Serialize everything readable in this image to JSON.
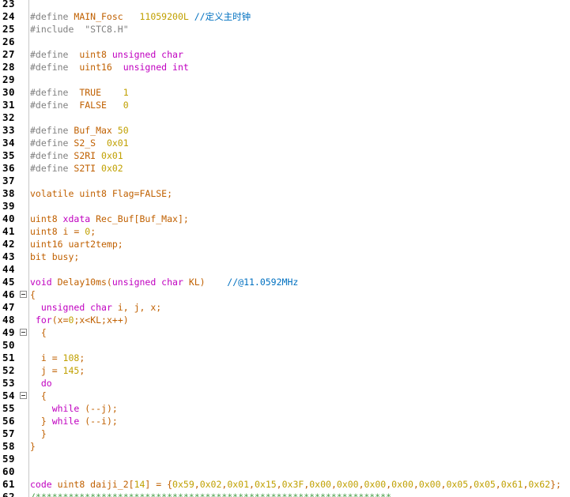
{
  "editor": {
    "lines": [
      {
        "n": "23",
        "fold": false,
        "tokens": []
      },
      {
        "n": "24",
        "fold": false,
        "tokens": [
          {
            "t": "#define ",
            "c": "pre"
          },
          {
            "t": "MAIN_Fosc",
            "c": "id"
          },
          {
            "t": "   ",
            "c": "plain"
          },
          {
            "t": "11059200L",
            "c": "num"
          },
          {
            "t": " ",
            "c": "plain"
          },
          {
            "t": "//定义主时钟",
            "c": "cmt"
          }
        ]
      },
      {
        "n": "25",
        "fold": false,
        "tokens": [
          {
            "t": "#include  ",
            "c": "pre"
          },
          {
            "t": "\"STC8.H\"",
            "c": "str"
          }
        ]
      },
      {
        "n": "26",
        "fold": false,
        "tokens": []
      },
      {
        "n": "27",
        "fold": false,
        "tokens": [
          {
            "t": "#define  ",
            "c": "pre"
          },
          {
            "t": "uint8",
            "c": "id"
          },
          {
            "t": " ",
            "c": "plain"
          },
          {
            "t": "unsigned char",
            "c": "kw"
          }
        ]
      },
      {
        "n": "28",
        "fold": false,
        "tokens": [
          {
            "t": "#define  ",
            "c": "pre"
          },
          {
            "t": "uint16",
            "c": "id"
          },
          {
            "t": "  ",
            "c": "plain"
          },
          {
            "t": "unsigned int",
            "c": "kw"
          }
        ]
      },
      {
        "n": "29",
        "fold": false,
        "tokens": []
      },
      {
        "n": "30",
        "fold": false,
        "tokens": [
          {
            "t": "#define  ",
            "c": "pre"
          },
          {
            "t": "TRUE",
            "c": "id"
          },
          {
            "t": "    ",
            "c": "plain"
          },
          {
            "t": "1",
            "c": "num"
          }
        ]
      },
      {
        "n": "31",
        "fold": false,
        "tokens": [
          {
            "t": "#define  ",
            "c": "pre"
          },
          {
            "t": "FALSE",
            "c": "id"
          },
          {
            "t": "   ",
            "c": "plain"
          },
          {
            "t": "0",
            "c": "num"
          }
        ]
      },
      {
        "n": "32",
        "fold": false,
        "tokens": []
      },
      {
        "n": "33",
        "fold": false,
        "tokens": [
          {
            "t": "#define ",
            "c": "pre"
          },
          {
            "t": "Buf_Max",
            "c": "id"
          },
          {
            "t": " ",
            "c": "plain"
          },
          {
            "t": "50",
            "c": "num"
          }
        ]
      },
      {
        "n": "34",
        "fold": false,
        "tokens": [
          {
            "t": "#define ",
            "c": "pre"
          },
          {
            "t": "S2_S",
            "c": "id"
          },
          {
            "t": "  ",
            "c": "plain"
          },
          {
            "t": "0x01",
            "c": "num"
          }
        ]
      },
      {
        "n": "35",
        "fold": false,
        "tokens": [
          {
            "t": "#define ",
            "c": "pre"
          },
          {
            "t": "S2RI",
            "c": "id"
          },
          {
            "t": " ",
            "c": "plain"
          },
          {
            "t": "0x01",
            "c": "num"
          }
        ]
      },
      {
        "n": "36",
        "fold": false,
        "tokens": [
          {
            "t": "#define ",
            "c": "pre"
          },
          {
            "t": "S2TI",
            "c": "id"
          },
          {
            "t": " ",
            "c": "plain"
          },
          {
            "t": "0x02",
            "c": "num"
          }
        ]
      },
      {
        "n": "37",
        "fold": false,
        "tokens": []
      },
      {
        "n": "38",
        "fold": false,
        "tokens": [
          {
            "t": "volatile ",
            "c": "id"
          },
          {
            "t": "uint8 ",
            "c": "id"
          },
          {
            "t": "Flag=FALSE;",
            "c": "id"
          }
        ]
      },
      {
        "n": "39",
        "fold": false,
        "tokens": []
      },
      {
        "n": "40",
        "fold": false,
        "tokens": [
          {
            "t": "uint8 ",
            "c": "id"
          },
          {
            "t": "xdata ",
            "c": "kw"
          },
          {
            "t": "Rec_Buf[Buf_Max];",
            "c": "id"
          }
        ]
      },
      {
        "n": "41",
        "fold": false,
        "tokens": [
          {
            "t": "uint8 ",
            "c": "id"
          },
          {
            "t": "i = ",
            "c": "id"
          },
          {
            "t": "0",
            "c": "num"
          },
          {
            "t": ";",
            "c": "id"
          }
        ]
      },
      {
        "n": "42",
        "fold": false,
        "tokens": [
          {
            "t": "uint16 ",
            "c": "id"
          },
          {
            "t": "uart2temp;",
            "c": "id"
          }
        ]
      },
      {
        "n": "43",
        "fold": false,
        "tokens": [
          {
            "t": "bit ",
            "c": "id"
          },
          {
            "t": "busy;",
            "c": "id"
          }
        ]
      },
      {
        "n": "44",
        "fold": false,
        "tokens": []
      },
      {
        "n": "45",
        "fold": false,
        "tokens": [
          {
            "t": "void ",
            "c": "kw"
          },
          {
            "t": "Delay10ms(",
            "c": "id"
          },
          {
            "t": "unsigned char ",
            "c": "kw"
          },
          {
            "t": "KL)",
            "c": "id"
          },
          {
            "t": "    ",
            "c": "plain"
          },
          {
            "t": "//@11.0592MHz",
            "c": "cmt"
          }
        ]
      },
      {
        "n": "46",
        "fold": true,
        "tokens": [
          {
            "t": "{",
            "c": "op"
          }
        ]
      },
      {
        "n": "47",
        "fold": false,
        "tokens": [
          {
            "t": "  ",
            "c": "plain"
          },
          {
            "t": "unsigned char ",
            "c": "kw"
          },
          {
            "t": "i, j, x;",
            "c": "id"
          }
        ]
      },
      {
        "n": "48",
        "fold": false,
        "tokens": [
          {
            "t": " ",
            "c": "plain"
          },
          {
            "t": "for",
            "c": "kw"
          },
          {
            "t": "(x=",
            "c": "id"
          },
          {
            "t": "0",
            "c": "num"
          },
          {
            "t": ";x<KL;x++)",
            "c": "id"
          }
        ]
      },
      {
        "n": "49",
        "fold": true,
        "tokens": [
          {
            "t": "  {",
            "c": "op"
          }
        ]
      },
      {
        "n": "50",
        "fold": false,
        "tokens": []
      },
      {
        "n": "51",
        "fold": false,
        "tokens": [
          {
            "t": "  i = ",
            "c": "id"
          },
          {
            "t": "108",
            "c": "num"
          },
          {
            "t": ";",
            "c": "id"
          }
        ]
      },
      {
        "n": "52",
        "fold": false,
        "tokens": [
          {
            "t": "  j = ",
            "c": "id"
          },
          {
            "t": "145",
            "c": "num"
          },
          {
            "t": ";",
            "c": "id"
          }
        ]
      },
      {
        "n": "53",
        "fold": false,
        "tokens": [
          {
            "t": "  do",
            "c": "kw"
          }
        ]
      },
      {
        "n": "54",
        "fold": true,
        "tokens": [
          {
            "t": "  {",
            "c": "op"
          }
        ]
      },
      {
        "n": "55",
        "fold": false,
        "tokens": [
          {
            "t": "    ",
            "c": "plain"
          },
          {
            "t": "while ",
            "c": "kw"
          },
          {
            "t": "(--j);",
            "c": "id"
          }
        ]
      },
      {
        "n": "56",
        "fold": false,
        "tokens": [
          {
            "t": "  } ",
            "c": "op"
          },
          {
            "t": "while ",
            "c": "kw"
          },
          {
            "t": "(--i);",
            "c": "id"
          }
        ]
      },
      {
        "n": "57",
        "fold": false,
        "tokens": [
          {
            "t": "  }",
            "c": "op"
          }
        ]
      },
      {
        "n": "58",
        "fold": false,
        "tokens": [
          {
            "t": "}",
            "c": "op"
          }
        ]
      },
      {
        "n": "59",
        "fold": false,
        "tokens": []
      },
      {
        "n": "60",
        "fold": false,
        "tokens": []
      },
      {
        "n": "61",
        "fold": false,
        "tokens": [
          {
            "t": "code ",
            "c": "kw"
          },
          {
            "t": "uint8 ",
            "c": "id"
          },
          {
            "t": "daiji_2[",
            "c": "id"
          },
          {
            "t": "14",
            "c": "num"
          },
          {
            "t": "] = {",
            "c": "id"
          },
          {
            "t": "0x59",
            "c": "num"
          },
          {
            "t": ",",
            "c": "id"
          },
          {
            "t": "0x02",
            "c": "num"
          },
          {
            "t": ",",
            "c": "id"
          },
          {
            "t": "0x01",
            "c": "num"
          },
          {
            "t": ",",
            "c": "id"
          },
          {
            "t": "0x15",
            "c": "num"
          },
          {
            "t": ",",
            "c": "id"
          },
          {
            "t": "0x3F",
            "c": "num"
          },
          {
            "t": ",",
            "c": "id"
          },
          {
            "t": "0x00",
            "c": "num"
          },
          {
            "t": ",",
            "c": "id"
          },
          {
            "t": "0x00",
            "c": "num"
          },
          {
            "t": ",",
            "c": "id"
          },
          {
            "t": "0x00",
            "c": "num"
          },
          {
            "t": ",",
            "c": "id"
          },
          {
            "t": "0x00",
            "c": "num"
          },
          {
            "t": ",",
            "c": "id"
          },
          {
            "t": "0x00",
            "c": "num"
          },
          {
            "t": ",",
            "c": "id"
          },
          {
            "t": "0x05",
            "c": "num"
          },
          {
            "t": ",",
            "c": "id"
          },
          {
            "t": "0x05",
            "c": "num"
          },
          {
            "t": ",",
            "c": "id"
          },
          {
            "t": "0x61",
            "c": "num"
          },
          {
            "t": ",",
            "c": "id"
          },
          {
            "t": "0x62",
            "c": "num"
          },
          {
            "t": "};",
            "c": "id"
          }
        ]
      },
      {
        "n": "62",
        "fold": false,
        "tokens": [
          {
            "t": "/*****************************************************************",
            "c": "cmtline"
          }
        ]
      }
    ]
  }
}
